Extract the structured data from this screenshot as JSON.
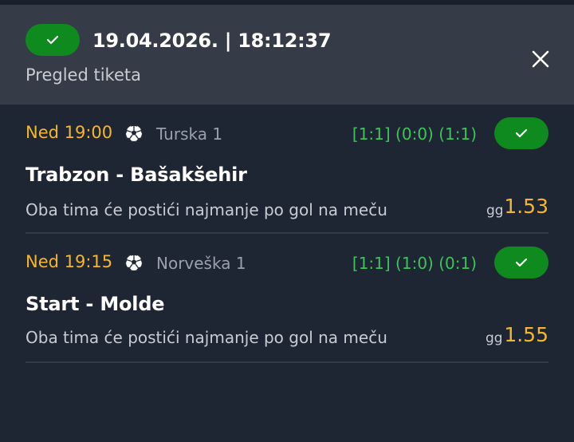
{
  "header": {
    "datetime": "19.04.2026. | 18:12:37",
    "subtitle": "Pregled tiketa",
    "status_icon": "check-icon",
    "close_icon": "close-icon"
  },
  "colors": {
    "background": "#1f2633",
    "header_bg": "#353c47",
    "success_green": "#0f8a1f",
    "score_green": "#3cc45a",
    "accent_orange": "#f5b62b"
  },
  "matches": [
    {
      "time": "Ned 19:00",
      "sport_icon": "soccer-ball-icon",
      "league": "Turska 1",
      "score": "[1:1] (0:0) (1:1)",
      "teams": "Trabzon - Bašakšehir",
      "market": "Oba tima će postići najmanje po gol na meču",
      "pick": "gg",
      "odd": "1.53"
    },
    {
      "time": "Ned 19:15",
      "sport_icon": "soccer-ball-icon",
      "league": "Norveška 1",
      "score": "[1:1] (1:0) (0:1)",
      "teams": "Start - Molde",
      "market": "Oba tima će postići najmanje po gol na meču",
      "pick": "gg",
      "odd": "1.55"
    }
  ]
}
